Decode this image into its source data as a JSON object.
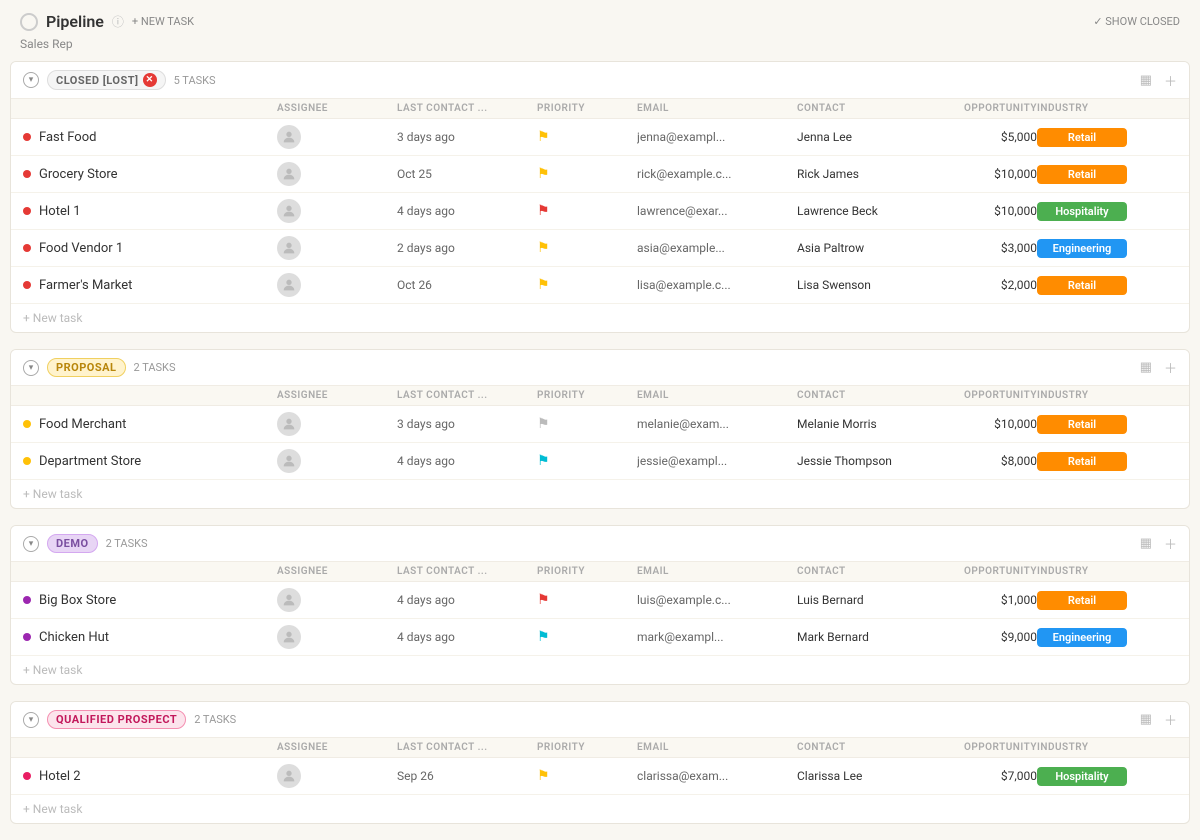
{
  "header": {
    "title": "Pipeline",
    "new_task": "+ NEW TASK",
    "show_closed": "✓ SHOW CLOSED",
    "subtitle": "Sales Rep"
  },
  "columns": [
    "ASSIGNEE",
    "LAST CONTACT ...",
    "PRIORITY",
    "EMAIL",
    "CONTACT",
    "OPPORTUNITY",
    "INDUSTRY"
  ],
  "sections": [
    {
      "id": "closed-lost",
      "tag": "CLOSED [LOST]",
      "tag_type": "closed",
      "task_count": "5 TASKS",
      "has_warning": true,
      "rows": [
        {
          "dot": "red",
          "name": "Fast Food",
          "last_contact": "3 days ago",
          "priority": "yellow",
          "email": "jenna@exampl...",
          "contact": "Jenna Lee",
          "opportunity": "$5,000",
          "industry": "Retail",
          "industry_type": "retail"
        },
        {
          "dot": "red",
          "name": "Grocery Store",
          "last_contact": "Oct 25",
          "priority": "yellow",
          "email": "rick@example.c...",
          "contact": "Rick James",
          "opportunity": "$10,000",
          "industry": "Retail",
          "industry_type": "retail"
        },
        {
          "dot": "red",
          "name": "Hotel 1",
          "last_contact": "4 days ago",
          "priority": "red",
          "email": "lawrence@exar...",
          "contact": "Lawrence Beck",
          "opportunity": "$10,000",
          "industry": "Hospitality",
          "industry_type": "hospitality"
        },
        {
          "dot": "red",
          "name": "Food Vendor 1",
          "last_contact": "2 days ago",
          "priority": "yellow",
          "email": "asia@example...",
          "contact": "Asia Paltrow",
          "opportunity": "$3,000",
          "industry": "Engineering",
          "industry_type": "engineering"
        },
        {
          "dot": "red",
          "name": "Farmer's Market",
          "last_contact": "Oct 26",
          "priority": "yellow",
          "email": "lisa@example.c...",
          "contact": "Lisa Swenson",
          "opportunity": "$2,000",
          "industry": "Retail",
          "industry_type": "retail"
        }
      ],
      "new_task_label": "+ New task"
    },
    {
      "id": "proposal",
      "tag": "PROPOSAL",
      "tag_type": "proposal",
      "task_count": "2 TASKS",
      "has_warning": false,
      "rows": [
        {
          "dot": "yellow",
          "name": "Food Merchant",
          "last_contact": "3 days ago",
          "priority": "gray",
          "email": "melanie@exam...",
          "contact": "Melanie Morris",
          "opportunity": "$10,000",
          "industry": "Retail",
          "industry_type": "retail"
        },
        {
          "dot": "yellow",
          "name": "Department Store",
          "last_contact": "4 days ago",
          "priority": "cyan",
          "email": "jessie@exampl...",
          "contact": "Jessie Thompson",
          "opportunity": "$8,000",
          "industry": "Retail",
          "industry_type": "retail"
        }
      ],
      "new_task_label": "+ New task"
    },
    {
      "id": "demo",
      "tag": "DEMO",
      "tag_type": "demo",
      "task_count": "2 TASKS",
      "has_warning": false,
      "rows": [
        {
          "dot": "purple",
          "name": "Big Box Store",
          "last_contact": "4 days ago",
          "priority": "red",
          "email": "luis@example.c...",
          "contact": "Luis Bernard",
          "opportunity": "$1,000",
          "industry": "Retail",
          "industry_type": "retail"
        },
        {
          "dot": "purple",
          "name": "Chicken Hut",
          "last_contact": "4 days ago",
          "priority": "cyan",
          "email": "mark@exampl...",
          "contact": "Mark Bernard",
          "opportunity": "$9,000",
          "industry": "Engineering",
          "industry_type": "engineering"
        }
      ],
      "new_task_label": "+ New task"
    },
    {
      "id": "qualified-prospect",
      "tag": "QUALIFIED PROSPECT",
      "tag_type": "qualified",
      "task_count": "2 TASKS",
      "has_warning": false,
      "rows": [
        {
          "dot": "pink",
          "name": "Hotel 2",
          "last_contact": "Sep 26",
          "priority": "yellow",
          "email": "clarissa@exam...",
          "contact": "Clarissa Lee",
          "opportunity": "$7,000",
          "industry": "Hospitality",
          "industry_type": "hospitality"
        }
      ],
      "new_task_label": "+ New task"
    }
  ]
}
